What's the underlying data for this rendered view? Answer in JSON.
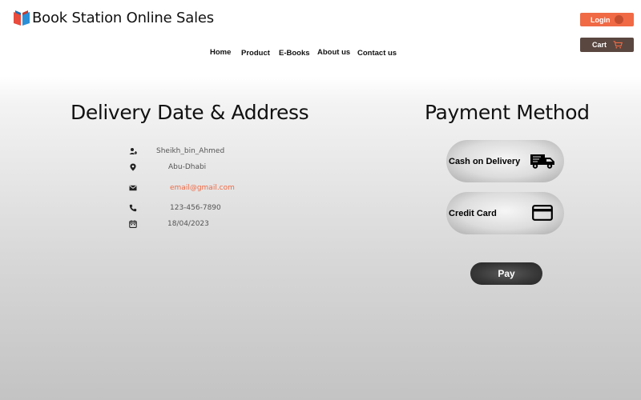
{
  "brand": {
    "name": "Book Station Online Sales",
    "accent": "#f06a45"
  },
  "nav": {
    "items": [
      "Home",
      "Product",
      "E-Books",
      "About us",
      "Contact us"
    ]
  },
  "header": {
    "login_label": "Login",
    "cart_label": "Cart"
  },
  "delivery": {
    "title": "Delivery Date & Address",
    "name": "Sheikh_bin_Ahmed",
    "location": "Abu-Dhabi",
    "email": "email@gmail.com",
    "phone": "123-456-7890",
    "date": "18/04/2023"
  },
  "payment": {
    "title": "Payment Method",
    "options": [
      {
        "label": "Cash on Delivery",
        "icon": "delivery-truck-icon"
      },
      {
        "label": "Credit Card",
        "icon": "credit-card-icon"
      }
    ],
    "pay_label": "Pay"
  }
}
